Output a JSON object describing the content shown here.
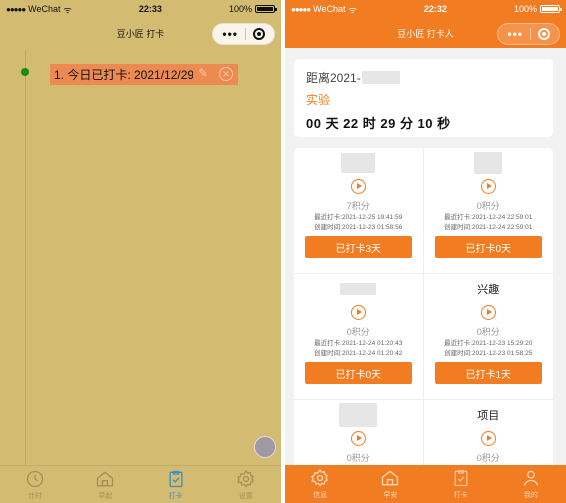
{
  "left": {
    "status": {
      "carrier": "WeChat",
      "signal": "●●●●●",
      "time": "22:33",
      "battery": "100%"
    },
    "title": "豆小匠 打卡",
    "capsule": {
      "more": "•••"
    },
    "record": {
      "text": "1. 今日已打卡: 2021/12/29",
      "edit": "✎",
      "delete": "✕"
    },
    "tabs": [
      {
        "label": "计时",
        "icon": "clock-icon"
      },
      {
        "label": "早起",
        "icon": "home-icon"
      },
      {
        "label": "打卡",
        "icon": "checklist-icon"
      },
      {
        "label": "设置",
        "icon": "gear-icon"
      }
    ],
    "colors": {
      "background": "#d3bc72",
      "record": "#ec8a52",
      "active_tab": "#3b8ec4",
      "dot": "#1a8a1a"
    }
  },
  "right": {
    "status": {
      "carrier": "WeChat",
      "signal": "●●●●●",
      "time": "22:32",
      "battery": "100%"
    },
    "title": "豆小匠 打卡人",
    "capsule": {
      "more": "•••"
    },
    "countdown": {
      "prefix": "距离2021-",
      "title": "实验",
      "time": "00 天 22 时 29 分 10 秒"
    },
    "items": [
      {
        "title": "",
        "points": "7积分",
        "last": "最近打卡:2021-12-25 19:41:59",
        "created": "创建时间:2021-12-23 01:58:56",
        "button": "已打卡3天"
      },
      {
        "title": "",
        "points": "0积分",
        "last": "最近打卡:2021-12-24 22:59:01",
        "created": "创建时间:2021-12-24 22:59:01",
        "button": "已打卡0天"
      },
      {
        "title": "",
        "points": "0积分",
        "last": "最近打卡:2021-12-24 01:20:43",
        "created": "创建时间:2021-12-24 01:20:42",
        "button": "已打卡0天"
      },
      {
        "title": "兴趣",
        "points": "0积分",
        "last": "最近打卡:2021-12-23 15:29:20",
        "created": "创建时间:2021-12-23 01:58:25",
        "button": "已打卡1天"
      },
      {
        "title": "",
        "points": "0积分",
        "last": "",
        "created": "",
        "button": ""
      },
      {
        "title": "项目",
        "points": "0积分",
        "last": "",
        "created": "",
        "button": ""
      }
    ],
    "tabs": [
      {
        "label": "信息",
        "icon": "gear-icon"
      },
      {
        "label": "早安",
        "icon": "home-icon"
      },
      {
        "label": "打卡",
        "icon": "checklist-icon"
      },
      {
        "label": "我的",
        "icon": "user-icon"
      }
    ],
    "colors": {
      "theme": "#f27c22",
      "page_bg": "#f2f2f2"
    }
  }
}
